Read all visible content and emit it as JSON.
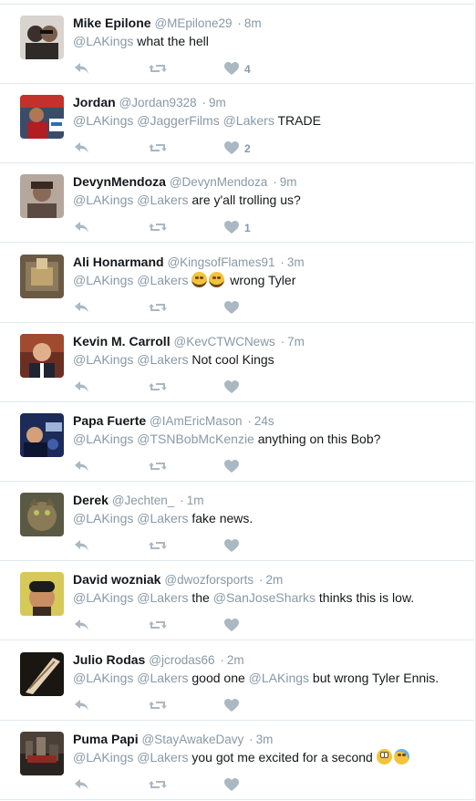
{
  "colors": {
    "name": "#14171a",
    "meta": "#8899a6",
    "icon": "#aab8c2",
    "divider": "#e1e8ed"
  },
  "icons": {
    "reply": "reply-icon",
    "retweet": "retweet-icon",
    "like": "heart-icon"
  },
  "tweets": [
    {
      "name": "Mike Epilone",
      "handle": "@MEpilone29",
      "time": "8m",
      "segments": [
        {
          "t": "@LAKings",
          "mention": true
        },
        {
          "t": " what the hell"
        }
      ],
      "likes": "4"
    },
    {
      "name": "Jordan",
      "handle": "@Jordan9328",
      "time": "9m",
      "segments": [
        {
          "t": "@LAKings",
          "mention": true
        },
        {
          "t": " "
        },
        {
          "t": "@JaggerFilms",
          "mention": true
        },
        {
          "t": " "
        },
        {
          "t": "@Lakers",
          "mention": true
        },
        {
          "t": " TRADE"
        }
      ],
      "likes": "2"
    },
    {
      "name": "DevynMendoza",
      "handle": "@DevynMendoza",
      "time": "9m",
      "segments": [
        {
          "t": "@LAKings",
          "mention": true
        },
        {
          "t": " "
        },
        {
          "t": "@Lakers",
          "mention": true
        },
        {
          "t": " are y'all trolling us?"
        }
      ],
      "likes": "1"
    },
    {
      "name": "Ali Honarmand",
      "handle": "@KingsofFlames91",
      "time": "3m",
      "segments": [
        {
          "t": "@LAKings",
          "mention": true
        },
        {
          "t": " "
        },
        {
          "t": "@Lakers",
          "mention": true
        },
        {
          "t": " "
        },
        {
          "emoji": "joy"
        },
        {
          "emoji": "joy"
        },
        {
          "t": " wrong Tyler"
        }
      ],
      "likes": ""
    },
    {
      "name": "Kevin M. Carroll",
      "handle": "@KevCTWCNews",
      "time": "7m",
      "segments": [
        {
          "t": "@LAKings",
          "mention": true
        },
        {
          "t": " "
        },
        {
          "t": "@Lakers",
          "mention": true
        },
        {
          "t": " Not cool Kings"
        }
      ],
      "likes": ""
    },
    {
      "name": "Papa Fuerte",
      "handle": "@IAmEricMason",
      "time": "24s",
      "segments": [
        {
          "t": "@LAKings",
          "mention": true
        },
        {
          "t": " "
        },
        {
          "t": "@TSNBobMcKenzie",
          "mention": true
        },
        {
          "t": " anything on this Bob?"
        }
      ],
      "likes": ""
    },
    {
      "name": "Derek",
      "handle": "@Jechten_",
      "time": "1m",
      "segments": [
        {
          "t": "@LAKings",
          "mention": true
        },
        {
          "t": " "
        },
        {
          "t": "@Lakers",
          "mention": true
        },
        {
          "t": " fake news."
        }
      ],
      "likes": ""
    },
    {
      "name": "David wozniak",
      "handle": "@dwozforsports",
      "time": "2m",
      "segments": [
        {
          "t": "@LAKings",
          "mention": true
        },
        {
          "t": " "
        },
        {
          "t": "@Lakers",
          "mention": true
        },
        {
          "t": " the "
        },
        {
          "t": "@SanJoseSharks",
          "mention": true
        },
        {
          "t": " thinks this is low."
        }
      ],
      "likes": ""
    },
    {
      "name": "Julio Rodas",
      "handle": "@jcrodas66",
      "time": "2m",
      "segments": [
        {
          "t": "@LAKings",
          "mention": true
        },
        {
          "t": " "
        },
        {
          "t": "@Lakers",
          "mention": true
        },
        {
          "t": " good one "
        },
        {
          "t": "@LAKings",
          "mention": true
        },
        {
          "t": " but wrong Tyler Ennis."
        }
      ],
      "likes": ""
    },
    {
      "name": "Puma Papi",
      "handle": "@StayAwakeDavy",
      "time": "3m",
      "segments": [
        {
          "t": "@LAKings",
          "mention": true
        },
        {
          "t": " "
        },
        {
          "t": "@Lakers",
          "mention": true
        },
        {
          "t": " you got me excited for a second "
        },
        {
          "emoji": "roll"
        },
        {
          "emoji": "cry"
        }
      ],
      "likes": ""
    }
  ]
}
